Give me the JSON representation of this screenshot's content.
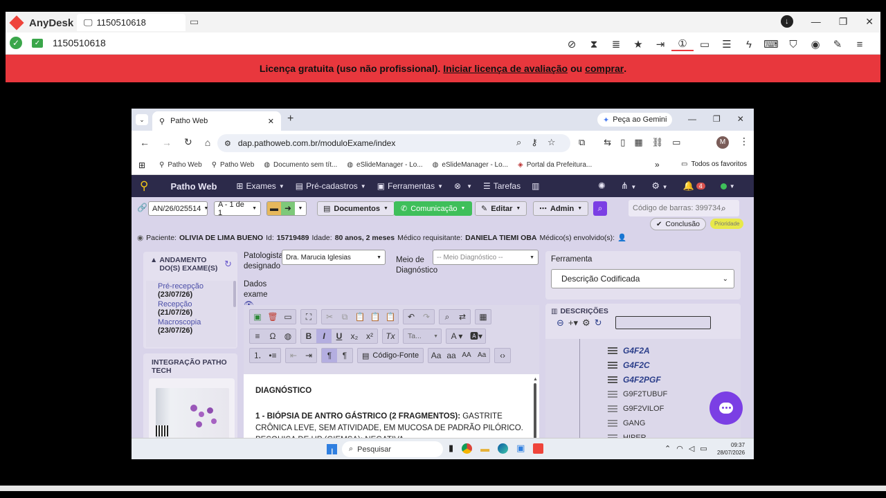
{
  "anydesk": {
    "app_name": "AnyDesk",
    "tab_label": "1150510618",
    "address_id": "1150510618",
    "banner": {
      "text_prefix": "Licença gratuita (uso não profissional).",
      "link_trial": "Iniciar licença de avaliação",
      "connector": "ou",
      "link_buy": "comprar",
      "suffix": "."
    },
    "accent": "#e8373d"
  },
  "chrome": {
    "tab_title": "Patho Web",
    "new_tab_symbol": "+",
    "gemini_button": "Peça ao Gemini",
    "url": "dap.pathoweb.com.br/moduloExame/index",
    "profile_initial": "M",
    "bookmarks": [
      {
        "label": "Patho Web"
      },
      {
        "label": "Patho Web"
      },
      {
        "label": "Documento sem tít..."
      },
      {
        "label": "eSlideManager - Lo..."
      },
      {
        "label": "eSlideManager - Lo..."
      },
      {
        "label": "Portal da Prefeitura..."
      }
    ],
    "bookmarks_more": "»",
    "all_favorites": "Todos os favoritos"
  },
  "app": {
    "brand": "Patho Web",
    "nav": [
      {
        "label": "Exames"
      },
      {
        "label": "Pré-cadastros"
      },
      {
        "label": "Ferramentas"
      },
      {
        "label": ""
      },
      {
        "label": "Tarefas"
      }
    ],
    "notification_count": "4",
    "user_status_color": "#3fbf5a",
    "toolbar": {
      "exam_code": "AN/26/025514",
      "sample_select": "A - 1 de 1",
      "documentos": "Documentos",
      "comunicacao": "Comunicação",
      "editar": "Editar",
      "admin": "Admin",
      "barcode_placeholder": "Código de barras: 399734",
      "conclusao": "Conclusão",
      "prioridade": "Prioridade"
    },
    "patient": {
      "label_paciente": "Paciente:",
      "name": "OLIVIA DE LIMA BUENO",
      "label_id": "Id:",
      "id": "15719489",
      "label_idade": "Idade:",
      "idade": "80 anos, 2 meses",
      "label_medico": "Médico requisitante:",
      "medico": "DANIELA TIEMI OBA",
      "label_envolvidos": "Médico(s) envolvido(s):"
    },
    "andamento": {
      "title": "ANDAMENTO DO(S) EXAME(S)",
      "steps": [
        {
          "name": "Pré-recepção",
          "date": "(23/07/26)"
        },
        {
          "name": "Recepção",
          "date": "(21/07/26)"
        },
        {
          "name": "Macroscopia",
          "date": "(23/07/26)"
        }
      ]
    },
    "integracao_title": "INTEGRAÇÃO PATHO TECH",
    "patologista_label": "Patologista designado",
    "patologista_value": "Dra. Marucia Iglesias",
    "meio_label": "Meio de Diagnóstico",
    "meio_placeholder": "-- Meio Diagnóstico --",
    "dados_exame_label": "Dados exame",
    "editor": {
      "font_select": "Ta...",
      "codigo_fonte": "Código-Fonte",
      "heading": "DIAGNÓSTICO",
      "item_label": "1 - BIÓPSIA DE ANTRO GÁSTRICO (2 FRAGMENTOS):",
      "item_text": "GASTRITE CRÔNICA LEVE, SEM ATIVIDADE, EM MUCOSA DE PADRÃO",
      "item_text_cut": "PILÓRICO. PESQUISA DE HP (GIEMSA): NEGATIVA."
    },
    "ferramenta_label": "Ferramenta",
    "ferramenta_value": "Descrição Codificada",
    "descricoes_title": "DESCRIÇÕES",
    "descricoes": [
      {
        "code": "G4F2A",
        "bold": true
      },
      {
        "code": "G4F2C",
        "bold": true
      },
      {
        "code": "G4F2PGF",
        "bold": true
      },
      {
        "code": "G9F2TUBUF",
        "bold": false
      },
      {
        "code": "G9F2VILOF",
        "bold": false
      },
      {
        "code": "GANG",
        "bold": false
      },
      {
        "code": "HIPER",
        "bold": false
      }
    ]
  },
  "taskbar": {
    "search_placeholder": "Pesquisar",
    "time": "09:37",
    "date": "28/07/2026"
  }
}
